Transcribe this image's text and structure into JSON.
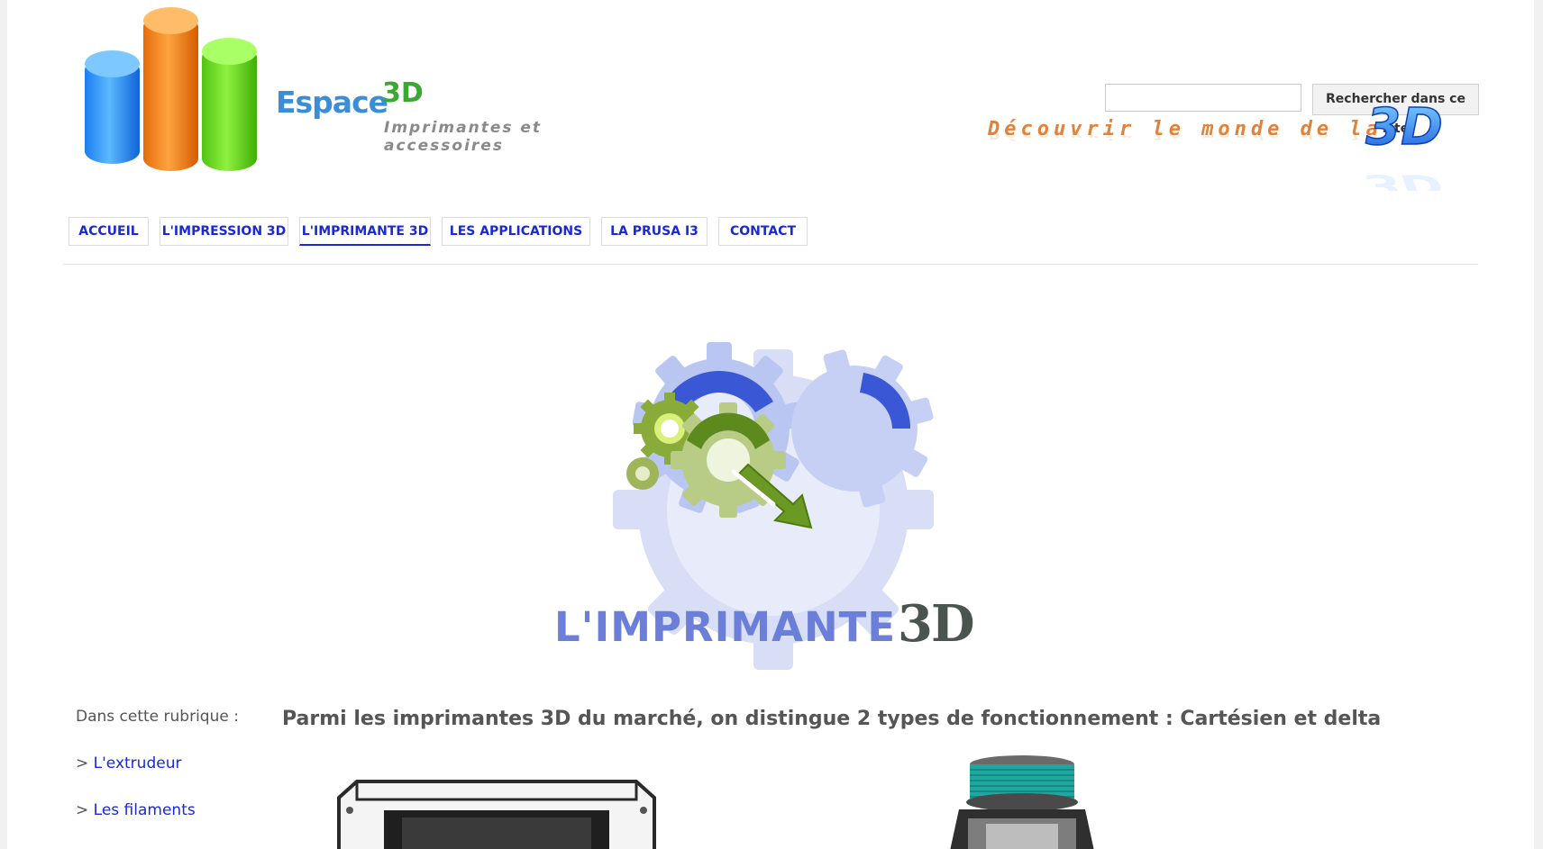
{
  "header": {
    "brand_name": "Espace",
    "brand_3d": "3D",
    "tagline": "Imprimantes et accessoires",
    "banner_text": "Découvrir le monde de la",
    "banner_logo": "3D"
  },
  "search": {
    "placeholder": "",
    "button_label": "Rechercher dans ce site"
  },
  "nav": {
    "items": [
      {
        "label": "ACCUEIL"
      },
      {
        "label": "L'IMPRESSION 3D"
      },
      {
        "label": "L'IMPRIMANTE 3D",
        "active": true
      },
      {
        "label": "LES APPLICATIONS"
      },
      {
        "label": "LA PRUSA I3"
      },
      {
        "label": "CONTACT"
      }
    ]
  },
  "hero": {
    "title": "L'IMPRIMANTE",
    "title_3d": "3D",
    "icon": "gears-arrow-icon"
  },
  "sidebar": {
    "title": "Dans cette rubrique :",
    "prefix": ">",
    "links": [
      {
        "label": "L'extrudeur"
      },
      {
        "label": "Les filaments"
      }
    ]
  },
  "content": {
    "lead": "Parmi les imprimantes 3D du marché, on distingue 2 types de fonctionnement : Cartésien et delta"
  },
  "colors": {
    "link": "#1a2ad2",
    "nav_text": "#1a2ad2",
    "body_text": "#555555",
    "hero_blue": "#6b7fd8",
    "orange": "#e0823a"
  }
}
